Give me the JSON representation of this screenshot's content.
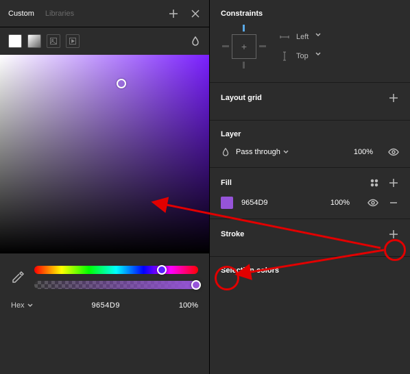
{
  "picker": {
    "tabs": [
      "Custom",
      "Libraries"
    ],
    "active_tab": 0,
    "color_mode": "Hex",
    "hex_value": "9654D9",
    "opacity": "100%",
    "swatch_types": [
      "solid",
      "linear",
      "image",
      "video"
    ],
    "current_color": "#9654D9"
  },
  "properties": {
    "constraints": {
      "title": "Constraints",
      "horizontal": "Left",
      "vertical": "Top"
    },
    "layout_grid": {
      "title": "Layout grid"
    },
    "layer": {
      "title": "Layer",
      "blend_mode": "Pass through",
      "opacity": "100%"
    },
    "fill": {
      "title": "Fill",
      "color_hex": "9654D9",
      "opacity": "100%"
    },
    "stroke": {
      "title": "Stroke"
    },
    "selection_colors": {
      "title": "Selection colors"
    }
  }
}
